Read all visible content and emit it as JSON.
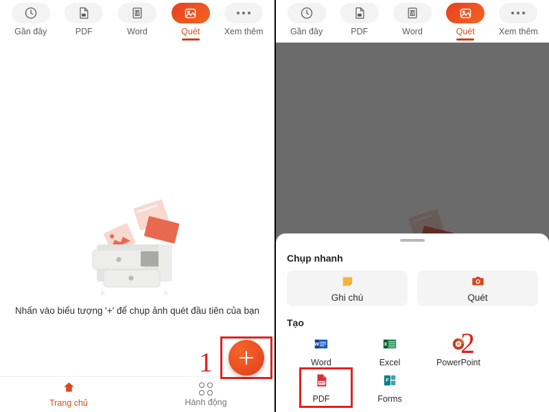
{
  "colors": {
    "accent": "#d64a1e",
    "fab_gradient_start": "#f4652a",
    "fab_gradient_end": "#e23a1c",
    "annotation_red": "#e02020",
    "word_blue": "#185abd",
    "excel_green": "#107c41",
    "powerpoint_orange": "#c43e1c",
    "pdf_red": "#d13438",
    "forms_teal": "#038387",
    "note_yellow": "#f2b33d",
    "scan_orange": "#d9451f"
  },
  "toolbar": {
    "items": [
      {
        "label": "Gần đây",
        "icon": "clock-icon",
        "active": false
      },
      {
        "label": "PDF",
        "icon": "pdf-file-icon",
        "active": false
      },
      {
        "label": "Word",
        "icon": "word-file-icon",
        "active": false
      },
      {
        "label": "Quét",
        "icon": "scan-image-icon",
        "active": true
      },
      {
        "label": "Xem thêm",
        "icon": "more-dots-icon",
        "active": false
      }
    ]
  },
  "left_panel": {
    "empty_state": {
      "illustration": "dresser-with-flying-papers-illustration",
      "message": "Nhấn vào biểu tượng '+' để chụp ảnh quét đầu tiên của bạn"
    },
    "fab": {
      "icon": "plus-icon",
      "label": "+"
    },
    "annotation": "1",
    "bottom_nav": [
      {
        "label": "Trang chủ",
        "icon": "home-icon",
        "active": true
      },
      {
        "label": "Hành động",
        "icon": "grid-actions-icon",
        "active": false
      }
    ]
  },
  "right_panel": {
    "sheet": {
      "handle": "drag-handle",
      "quick_capture": {
        "title": "Chụp nhanh",
        "buttons": [
          {
            "label": "Ghi chú",
            "icon": "sticky-note-icon"
          },
          {
            "label": "Quét",
            "icon": "camera-icon"
          }
        ]
      },
      "create": {
        "title": "Tạo",
        "apps": [
          {
            "label": "Word",
            "icon": "word-icon",
            "highlighted": false
          },
          {
            "label": "Excel",
            "icon": "excel-icon",
            "highlighted": false
          },
          {
            "label": "PowerPoint",
            "icon": "powerpoint-icon",
            "highlighted": false
          },
          {
            "label": "PDF",
            "icon": "pdf-icon",
            "highlighted": true
          },
          {
            "label": "Forms",
            "icon": "forms-icon",
            "highlighted": false
          }
        ]
      }
    },
    "annotation": "2"
  }
}
